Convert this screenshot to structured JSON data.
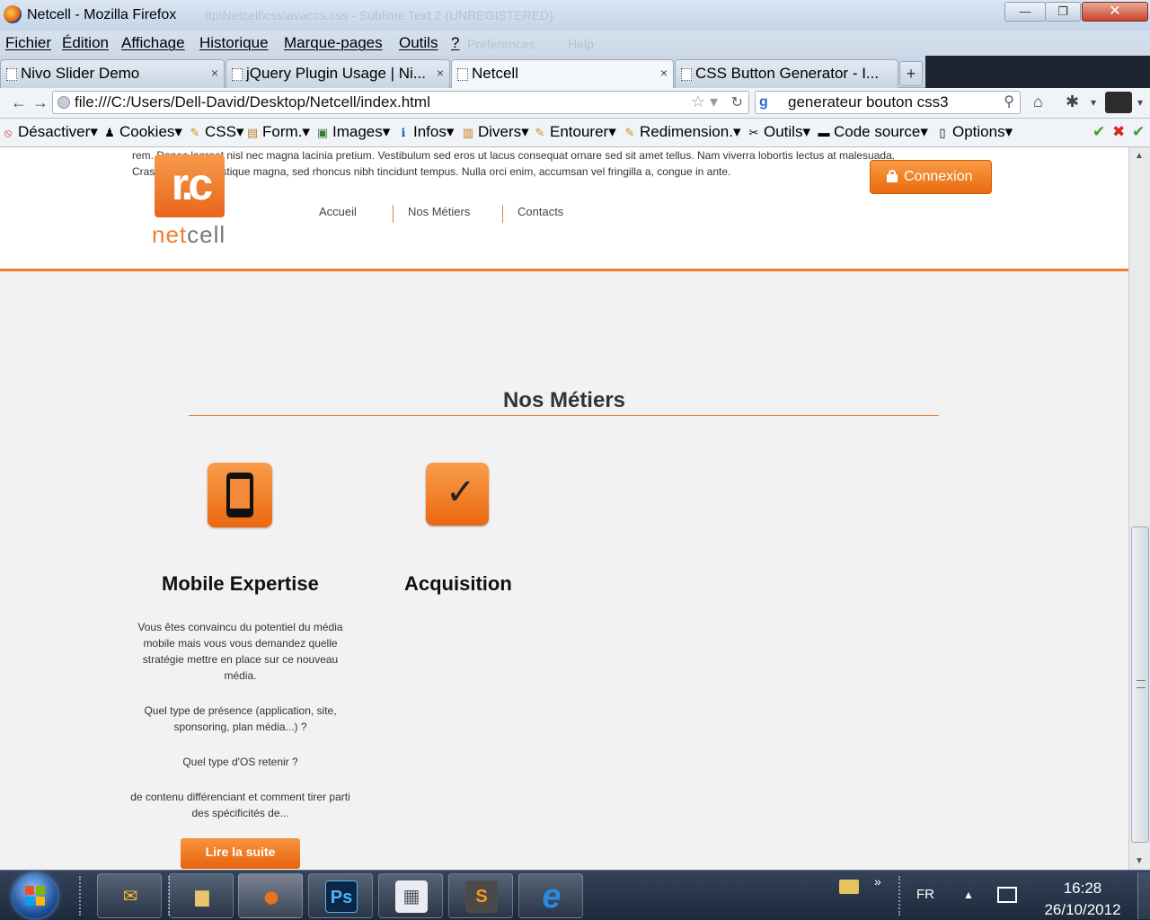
{
  "window": {
    "title": "Netcell - Mozilla Firefox",
    "ghost_title": "ttp\\Netcell\\css\\avaccs.css - Sublime Text 2 (UNREGISTERED)",
    "minimize": "—",
    "maximize": "❐",
    "close": "✕"
  },
  "menu": {
    "items": [
      "Fichier",
      "Édition",
      "Affichage",
      "Historique",
      "Marque-pages",
      "Outils",
      "?"
    ],
    "ghost_items": [
      "Preferences",
      "Help"
    ]
  },
  "tabs": [
    {
      "label": "Nivo Slider Demo",
      "active": false
    },
    {
      "label": "jQuery Plugin Usage | Ni...",
      "active": false
    },
    {
      "label": "Netcell",
      "active": true
    },
    {
      "label": "CSS Button Generator - I...",
      "active": false
    }
  ],
  "tab_close": "×",
  "new_tab": "+",
  "address": {
    "url": "file:///C:/Users/Dell-David/Desktop/Netcell/index.html",
    "star": "☆ ▾",
    "reload": "↻"
  },
  "search": {
    "engine_glyph": "g",
    "value": "generateur bouton css3",
    "button_glyph": "⚲"
  },
  "navigation": {
    "back": "←",
    "forward": "→",
    "home": "⌂"
  },
  "webdev_toolbar": {
    "items": [
      {
        "label": "Désactiver",
        "icon": "no-entry-icon",
        "glyph": "⦸"
      },
      {
        "label": "Cookies",
        "icon": "person-icon",
        "glyph": "♟"
      },
      {
        "label": "CSS",
        "icon": "pencil-icon",
        "glyph": "✎"
      },
      {
        "label": "Form.",
        "icon": "clipboard-icon",
        "glyph": "▤"
      },
      {
        "label": "Images",
        "icon": "image-icon",
        "glyph": "▣"
      },
      {
        "label": "Infos",
        "icon": "info-icon",
        "glyph": "ℹ"
      },
      {
        "label": "Divers",
        "icon": "book-icon",
        "glyph": "▥"
      },
      {
        "label": "Entourer",
        "icon": "pencil-icon",
        "glyph": "✎"
      },
      {
        "label": "Redimension.",
        "icon": "pencil-icon",
        "glyph": "✎"
      },
      {
        "label": "Outils",
        "icon": "tools-icon",
        "glyph": "✂"
      },
      {
        "label": "Code source",
        "icon": "monitor-icon",
        "glyph": "▬"
      },
      {
        "label": "Options",
        "icon": "document-icon",
        "glyph": "▯"
      }
    ],
    "status_ok": "✔",
    "status_error": "✖"
  },
  "page": {
    "header_text_line1": "rem. Donec laoreet nisl nec magna lacinia pretium. Vestibulum sed eros ut lacus consequat ornare sed sit amet tellus. Nam viverra lobortis lectus at malesuada.",
    "header_text_line2": "Cras vestibulum tristique magna, sed rhoncus nibh tincidunt tempus. Nulla orci enim, accumsan vel fringilla a, congue in ante.",
    "logo_mark": "r.c",
    "logo_word_a": "net",
    "logo_word_b": "cell",
    "nav": [
      "Accueil",
      "Nos Métiers",
      "Contacts"
    ],
    "connexion_label": "Connexion",
    "section_title": "Nos Métiers",
    "services": [
      {
        "title": "Mobile Expertise",
        "icon": "smartphone-icon",
        "paragraphs": [
          "Vous êtes convaincu du potentiel du média mobile mais vous vous demandez quelle stratégie mettre en place sur ce nouveau média.",
          "Quel type de présence (application, site, sponsoring, plan média...) ?",
          "Quel type d'OS retenir ?",
          "de contenu différenciant et comment tirer parti des spécificités de..."
        ],
        "button": "Lire la suite"
      },
      {
        "title": "Acquisition",
        "icon": "checkmark-icon",
        "glyph": "✓"
      }
    ]
  },
  "scrollbar": {
    "up": "▲",
    "down": "▼"
  },
  "taskbar": {
    "apps": [
      {
        "name": "outlook",
        "glyph": "✉",
        "color": "#f2b632"
      },
      {
        "name": "explorer",
        "glyph": "▆",
        "color": "#e8c56a"
      },
      {
        "name": "firefox",
        "glyph": "●",
        "color": "#e8731c"
      },
      {
        "name": "photoshop",
        "glyph": "Ps",
        "color": "#0b2745"
      },
      {
        "name": "calculator",
        "glyph": "▦",
        "color": "#e9edf3"
      },
      {
        "name": "sublime-text",
        "glyph": "S",
        "color": "#4a4a4a"
      },
      {
        "name": "internet-explorer",
        "glyph": "e",
        "color": "#2a8be0"
      }
    ],
    "overflow": "»",
    "language": "FR",
    "tray_arrow": "▲",
    "time": "16:28",
    "date": "26/10/2012"
  }
}
